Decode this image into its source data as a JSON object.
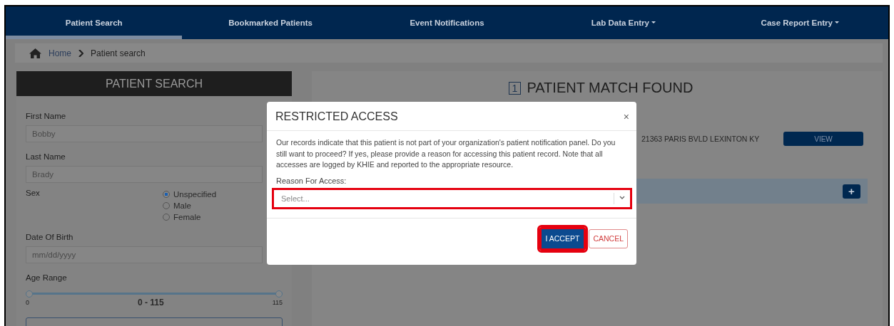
{
  "nav": {
    "tabs": [
      {
        "label": "Patient Search",
        "selected": true,
        "dropdown": false
      },
      {
        "label": "Bookmarked Patients",
        "selected": false,
        "dropdown": false
      },
      {
        "label": "Event Notifications",
        "selected": false,
        "dropdown": false
      },
      {
        "label": "Lab Data Entry",
        "selected": false,
        "dropdown": true
      },
      {
        "label": "Case Report Entry",
        "selected": false,
        "dropdown": true
      }
    ]
  },
  "breadcrumb": {
    "items": [
      "Home",
      "Patient search"
    ]
  },
  "search_panel": {
    "title": "PATIENT SEARCH",
    "fields": [
      {
        "kind": "text",
        "label": "First Name",
        "value": "Bobby"
      },
      {
        "kind": "text",
        "label": "Last Name",
        "value": "Brady"
      },
      {
        "kind": "radio",
        "label": "Sex",
        "options": [
          {
            "label": "Unspecified",
            "selected": true
          },
          {
            "label": "Male",
            "selected": false
          },
          {
            "label": "Female",
            "selected": false
          }
        ]
      },
      {
        "kind": "date",
        "label": "Date Of Birth",
        "placeholder": "mm/dd/yyyy"
      },
      {
        "kind": "range",
        "label": "Age Range",
        "min": "0",
        "max": "115",
        "reading": "0 - 115"
      }
    ]
  },
  "results": {
    "count": "1",
    "title": "PATIENT MATCH FOUND",
    "address": "21363 PARIS BVLD LEXINTON KY",
    "view_button": "VIEW",
    "add_button": "+"
  },
  "modal": {
    "title": "RESTRICTED ACCESS",
    "close": "×",
    "message": "Our records indicate that this patient is not part of your organization's patient notification panel. Do you still want to proceed? If yes, please provide a reason for accessing this patient record. Note that all accesses are logged by KHIE and reported to the appropriate resource.",
    "field_label": "Reason For Access:",
    "select": {
      "placeholder": "Select...",
      "highlighted": true
    },
    "buttons": [
      {
        "label": "I ACCEPT",
        "kind": "primary",
        "highlighted": true
      },
      {
        "label": "CANCEL",
        "kind": "secondary",
        "highlighted": false
      }
    ]
  }
}
